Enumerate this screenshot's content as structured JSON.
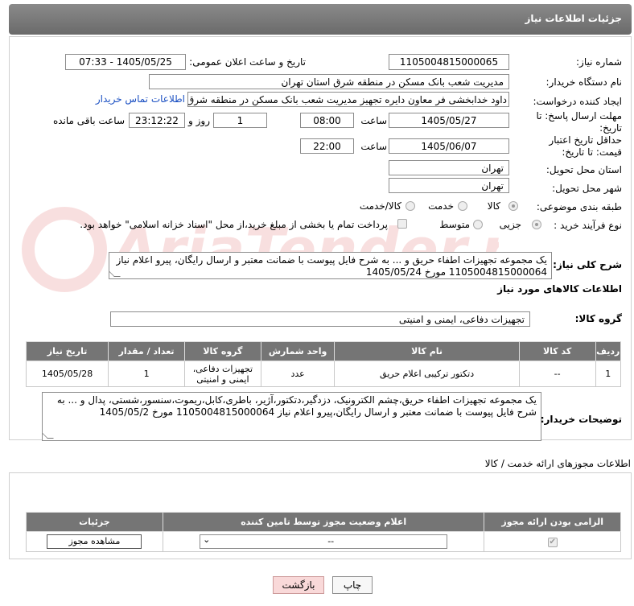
{
  "header": {
    "title": "جزئیات اطلاعات نیاز"
  },
  "form": {
    "need_number_label": "شماره نیاز:",
    "need_number": "1105004815000065",
    "announce_label": "تاریخ و ساعت اعلان عمومی:",
    "announce_value": "1405/05/25 - 07:33",
    "buyer_org_label": "نام دستگاه خریدار:",
    "buyer_org": "مدیریت شعب بانک مسکن در منطقه شرق استان تهران",
    "creator_label": "ایجاد کننده درخواست:",
    "creator": "داود خدابخشی فر معاون دایره تجهیز مدیریت شعب بانک مسکن در منطقه شرق",
    "contact_link": "اطلاعات تماس خریدار",
    "deadline_label": "مهلت ارسال پاسخ: تا تاریخ:",
    "deadline_date": "1405/05/27",
    "time_label": "ساعت",
    "deadline_time": "08:00",
    "days_value": "1",
    "days_label": "روز و",
    "remaining_time": "23:12:22",
    "remaining_label": "ساعت باقی مانده",
    "validity_label": "حداقل تاریخ اعتبار قیمت: تا تاریخ:",
    "validity_date": "1405/06/07",
    "validity_time": "22:00",
    "province_label": "استان محل تحویل:",
    "province": "تهران",
    "city_label": "شهر محل تحویل:",
    "city": "تهران",
    "category_label": "طبقه بندی موضوعی:",
    "category_options": [
      "کالا",
      "خدمت",
      "کالا/خدمت"
    ],
    "process_label": "نوع فرآیند خرید :",
    "process_options": [
      "جزیی",
      "متوسط"
    ],
    "payment_note": "پرداخت تمام یا بخشی از مبلغ خرید،از محل \"اسناد خزانه اسلامی\" خواهد بود."
  },
  "description": {
    "label": "شرح کلی نیاز:",
    "text": "یک مجموعه تجهیزات اطفاء حریق و ... به شرح فایل پیوست با ضمانت معتبر و ارسال رایگان، پیرو اعلام نیاز 1105004815000064 مورخ 1405/05/24"
  },
  "goods_section_title": "اطلاعات کالاهای مورد نیاز",
  "goods_group": {
    "label": "گروه کالا:",
    "value": "تجهیزات دفاعی، ایمنی و امنیتی"
  },
  "goods_table": {
    "headers": [
      "ردیف",
      "کد کالا",
      "نام کالا",
      "واحد شمارش",
      "گروه کالا",
      "تعداد / مقدار",
      "تاریخ نیاز"
    ],
    "rows": [
      [
        "1",
        "--",
        "دتکتور ترکیبی اعلام حریق",
        "عدد",
        "تجهیزات دفاعی، ایمنی و امنیتی",
        "1",
        "1405/05/28"
      ]
    ]
  },
  "buyer_notes": {
    "label": "توضیحات خریدار:",
    "text": "یک مجموعه تجهیزات اطفاء حریق،چشم الکترونیک، دزدگیر،دتکتور،آژیر، باطری،کابل،ریموت،سنسور،شستی، پدال و ... به شرح فایل پیوست با ضمانت معتبر و ارسال رایگان،پیرو اعلام نیاز 1105004815000064 مورخ 1405/05/2"
  },
  "license_section_title": "اطلاعات مجوزهای ارائه خدمت / کالا",
  "license_table": {
    "headers": [
      "الزامی بودن ارائه مجوز",
      "اعلام وضعیت مجوز توسط تامین کننده",
      "جزئیات"
    ],
    "select_value": "--",
    "view_button": "مشاهده مجوز"
  },
  "buttons": {
    "print": "چاپ",
    "back": "بازگشت"
  },
  "watermark_text": "AriaTender.net"
}
